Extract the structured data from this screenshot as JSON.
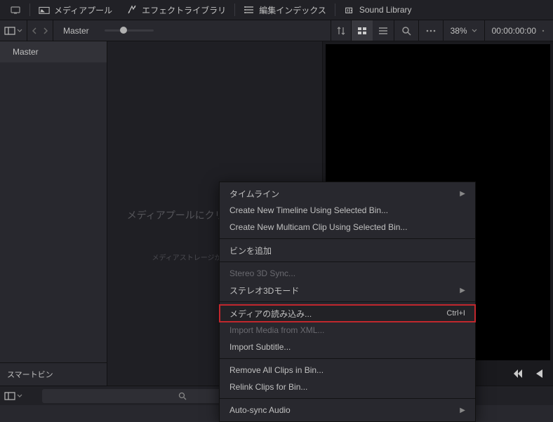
{
  "topbar": {
    "media_pool": "メディアプール",
    "effects_library": "エフェクトライブラリ",
    "edit_index": "編集インデックス",
    "sound_library": "Sound Library"
  },
  "secondbar": {
    "breadcrumb": "Master",
    "zoom": "38%",
    "timecode": "00:00:00:00"
  },
  "left_panel": {
    "bin": "Master",
    "smart_bin": "スマートビン"
  },
  "center_panel": {
    "placeholder_main": "メディアプールにクリップがありません",
    "placeholder_sub": "メディアストレージからクリップを追加"
  },
  "context_menu": {
    "timeline": "タイムライン",
    "create_timeline": "Create New Timeline Using Selected Bin...",
    "create_multicam": "Create New Multicam Clip Using Selected Bin...",
    "add_bin": "ビンを追加",
    "stereo3d_sync": "Stereo 3D Sync...",
    "stereo3d_mode": "ステレオ3Dモード",
    "import_media": "メディアの読み込み...",
    "import_media_shortcut": "Ctrl+I",
    "import_xml": "Import Media from XML...",
    "import_subtitle": "Import Subtitle...",
    "remove_clips": "Remove All Clips in Bin...",
    "relink_clips": "Relink Clips for Bin...",
    "autosync": "Auto-sync Audio"
  }
}
